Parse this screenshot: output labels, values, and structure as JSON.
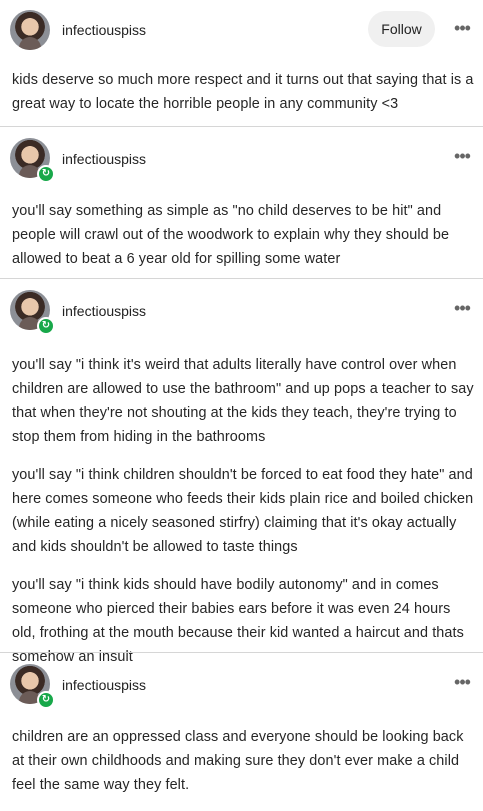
{
  "posts": [
    {
      "username": "infectiouspiss",
      "follow_label": "Follow",
      "more_label": "•••",
      "reblog_icon": "↻",
      "paragraphs": [
        "kids deserve so much more respect and it turns out that saying that is a great way to locate the horrible people in any community <3"
      ]
    },
    {
      "username": "infectiouspiss",
      "more_label": "•••",
      "reblog_icon": "↻",
      "paragraphs": [
        "you'll say something as simple as \"no child deserves to be hit\" and people will crawl out of the woodwork to explain why they should be allowed to beat a 6 year old for spilling some water"
      ]
    },
    {
      "username": "infectiouspiss",
      "more_label": "•••",
      "reblog_icon": "↻",
      "paragraphs": [
        "you'll say \"i think it's weird that adults literally have control over when children are allowed to use the bathroom\" and up pops a teacher to say that when they're not shouting at the kids they teach, they're trying to stop them from hiding in the bathrooms",
        "you'll say \"i think children shouldn't be forced to eat food they hate\" and here comes someone who feeds their kids plain rice and boiled chicken (while eating a nicely seasoned stirfry) claiming that it's okay actually and kids shouldn't be allowed to taste things",
        "you'll say \"i think kids should have bodily autonomy\" and in comes someone who pierced their babies ears before it was even 24 hours old, frothing at the mouth because their kid wanted a haircut and thats somehow an insult"
      ]
    },
    {
      "username": "infectiouspiss",
      "more_label": "•••",
      "reblog_icon": "↻",
      "paragraphs": [
        "children are an oppressed class and everyone should be looking back at their own childhoods and making sure they don't ever make a child feel the same way they felt."
      ]
    }
  ]
}
